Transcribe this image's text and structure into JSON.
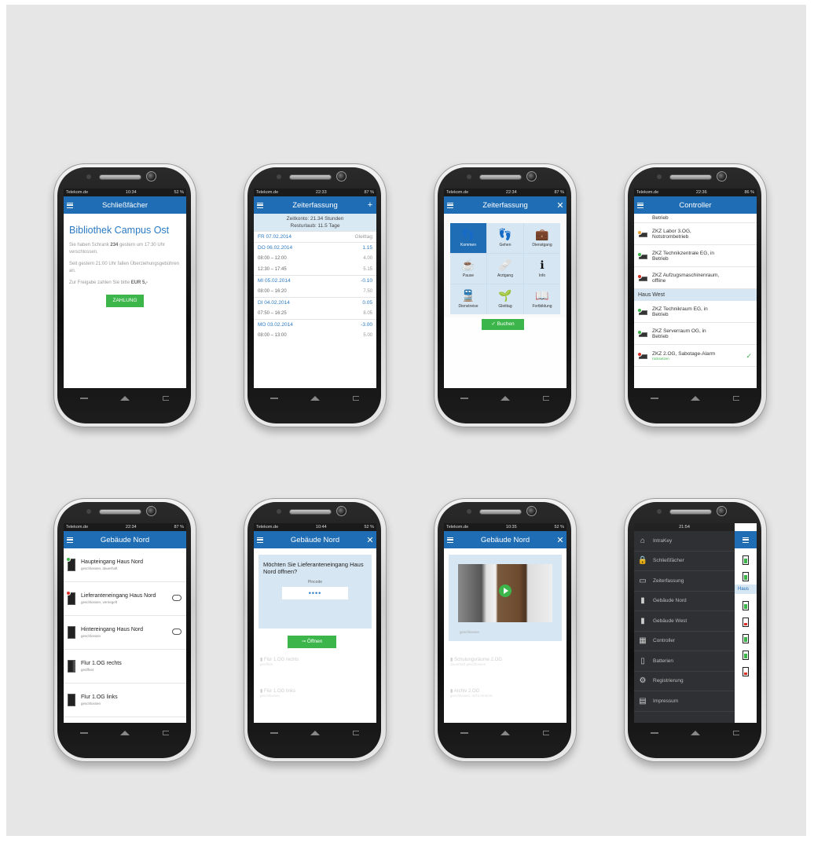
{
  "colors": {
    "brand": "#1e6db5",
    "green": "#3cb54a",
    "section": "#d6e6f2",
    "background": "#e6e6e6"
  },
  "phones": [
    {
      "status": {
        "carrier": "Telekom.de",
        "time": "10:34",
        "battery": "52 %"
      },
      "title": "Schließfächer",
      "heading": "Bibliothek Campus Ost",
      "p1a": "Sie haben Schrank",
      "p1b": "234",
      "p1c": "gestern um 17:30 Uhr verschlossen.",
      "p2": "Seit gestern 21:00 Uhr fallen Überziehungsgebühren an.",
      "p3a": "Zur Freigabe zahlen Sie bitte",
      "p3b": "EUR 5,-",
      "button": "ZAHLUNG"
    },
    {
      "status": {
        "carrier": "Telekom.de",
        "time": "22:33",
        "battery": "87 %"
      },
      "title": "Zeiterfassung",
      "info1": "Zeitkonto: 21.34 Stunden",
      "info2": "Resturlaub: 11.5 Tage",
      "rows": [
        {
          "day": "FR  07.02.2014",
          "val": "Gleittag",
          "type": "day",
          "gl": true
        },
        {
          "day": "DO  06.02.2014",
          "val": "1.15",
          "type": "day"
        },
        {
          "day": "08:00  –  12:00",
          "val": "4.00",
          "type": "time"
        },
        {
          "day": "12:30  –  17:45",
          "val": "5.15",
          "type": "time"
        },
        {
          "day": "MI  05.02.2014",
          "val": "-0.10",
          "type": "day"
        },
        {
          "day": "08:00  –  16:20",
          "val": "7.50",
          "type": "time"
        },
        {
          "day": "DI  04.02.2014",
          "val": "0.05",
          "type": "day"
        },
        {
          "day": "07:50  –  16:25",
          "val": "8.05",
          "type": "time"
        },
        {
          "day": "MO  03.02.2014",
          "val": "-3.00",
          "type": "day"
        },
        {
          "day": "08:00  –  13:00",
          "val": "5.00",
          "type": "time"
        }
      ]
    },
    {
      "status": {
        "carrier": "Telekom.de",
        "time": "22:34",
        "battery": "87 %"
      },
      "title": "Zeiterfassung",
      "tiles": [
        {
          "label": "Kommen",
          "icon": "footprints-in-icon",
          "glyph": "👣"
        },
        {
          "label": "Gehen",
          "icon": "footprints-out-icon",
          "glyph": "👣"
        },
        {
          "label": "Dienstgang",
          "icon": "briefcase-icon",
          "glyph": "💼"
        },
        {
          "label": "Pause",
          "icon": "coffee-cup-icon",
          "glyph": "☕"
        },
        {
          "label": "Arztgang",
          "icon": "bandage-icon",
          "glyph": "🩹"
        },
        {
          "label": "Info",
          "icon": "info-icon",
          "glyph": "ℹ"
        },
        {
          "label": "Dienstreise",
          "icon": "train-icon",
          "glyph": "🚆"
        },
        {
          "label": "Gleittag",
          "icon": "plant-icon",
          "glyph": "🌱"
        },
        {
          "label": "Fortbildung",
          "icon": "book-icon",
          "glyph": "📖"
        }
      ],
      "button": "Buchen"
    },
    {
      "status": {
        "carrier": "Telekom.de",
        "time": "22:36",
        "battery": "86 %"
      },
      "title": "Controller",
      "top": "Betrieb",
      "items1": [
        {
          "name": "ZKZ Labor 3.OG,",
          "sub": "Notstrombetrieb",
          "dot": "#e8a33a"
        },
        {
          "name": "ZKZ Technikzentrale EG, in",
          "sub": "Betrieb",
          "dot": "#3cb54a"
        },
        {
          "name": "ZKZ Aufzugsmaschinenraum,",
          "sub": "offline",
          "dot": "#d93025"
        }
      ],
      "section": "Haus West",
      "items2": [
        {
          "name": "ZKZ Technikraum EG, in",
          "sub": "Betrieb",
          "dot": "#3cb54a"
        },
        {
          "name": "ZKZ Serverraum OG, in",
          "sub": "Betrieb",
          "dot": "#3cb54a"
        }
      ],
      "alarm": {
        "name": "ZKZ 2.OG, Sabotage-Alarm",
        "sub": "rücksetzen",
        "dot": "#d93025"
      }
    },
    {
      "status": {
        "carrier": "Telekom.de",
        "time": "22:34",
        "battery": "87 %"
      },
      "title": "Gebäude Nord",
      "doors": [
        {
          "name": "Haupteingang Haus Nord",
          "sub": "geschlossen, dauerhaft",
          "dot": "#3cb54a",
          "key": false
        },
        {
          "name": "Lieferanteneingang Haus Nord",
          "sub": "geschlossen, verriegelt",
          "dot": "#d93025",
          "key": true
        },
        {
          "name": "Hintereingang Haus Nord",
          "sub": "geschlossen",
          "dot": "",
          "key": true
        },
        {
          "name": "Flur 1.OG rechts",
          "sub": "geöffnet",
          "dot": "",
          "key": false
        },
        {
          "name": "Flur 1.OG links",
          "sub": "geschlossen",
          "dot": "",
          "key": false
        }
      ]
    },
    {
      "status": {
        "carrier": "Telekom.de",
        "time": "10:44",
        "battery": "52 %"
      },
      "title": "Gebäude Nord",
      "question": "Möchten Sie Lieferanteneingang Haus Nord öffnen?",
      "pin_label": "Pincode",
      "pin": "••••",
      "button": "Öffnen",
      "ghost1": "Flur 1.OG rechts",
      "ghost1_sub": "geöffnet",
      "ghost2": "Flur 1.OG links",
      "ghost2_sub": "geschlossen"
    },
    {
      "status": {
        "carrier": "Telekom.de",
        "time": "10:35",
        "battery": "52 %"
      },
      "title": "Gebäude Nord",
      "ghost0": "geschlossen",
      "ghost1": "Schulungsräume 2.OG",
      "ghost1_sub": "dauerhaft geschlossen",
      "ghost2": "Archiv 2.OG",
      "ghost2_sub": "geschlossen, nicht erreicht"
    },
    {
      "status": {
        "time": "21:54"
      },
      "menu": [
        {
          "label": "IntraKey",
          "icon": "house-icon",
          "glyph": "⌂"
        },
        {
          "label": "Schließfächer",
          "icon": "padlock-icon",
          "glyph": "🔒"
        },
        {
          "label": "Zeiterfassung",
          "icon": "card-icon",
          "glyph": "▭"
        },
        {
          "label": "Gebäude Nord",
          "icon": "door-icon",
          "glyph": "▮"
        },
        {
          "label": "Gebäude West",
          "icon": "door-icon",
          "glyph": "▮"
        },
        {
          "label": "Controller",
          "icon": "controller-icon",
          "glyph": "▦"
        },
        {
          "label": "Batterien",
          "icon": "battery-icon",
          "glyph": "▯"
        },
        {
          "label": "Registrierung",
          "icon": "gears-icon",
          "glyph": "⚙"
        },
        {
          "label": "Impressum",
          "icon": "document-icon",
          "glyph": "▤"
        }
      ],
      "haus": "Haus"
    }
  ]
}
